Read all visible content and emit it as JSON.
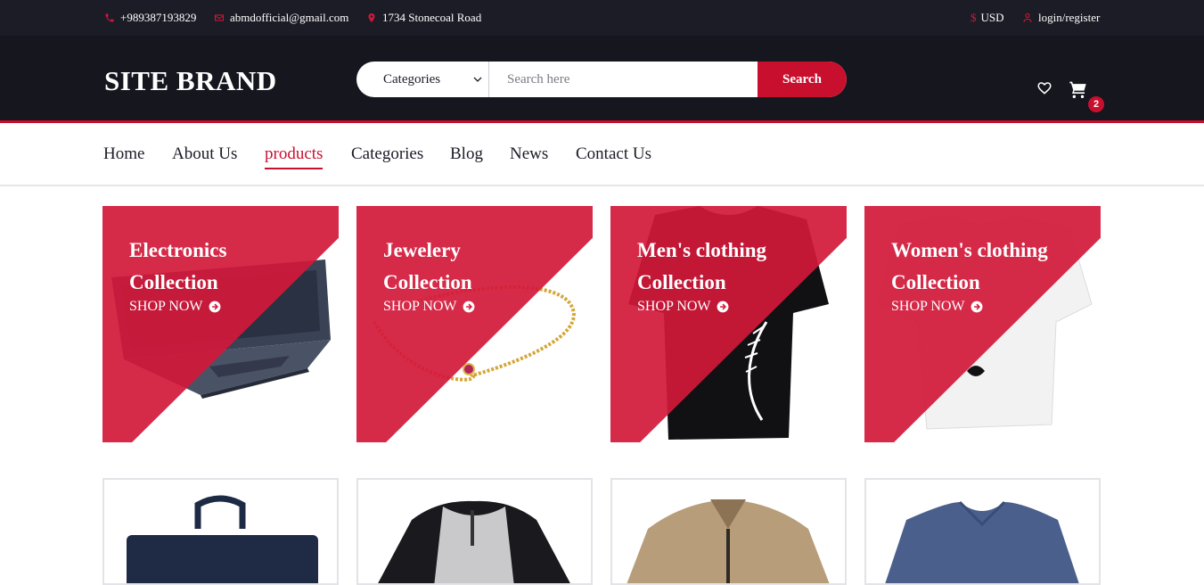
{
  "topbar": {
    "phone": "+989387193829",
    "email": "abmdofficial@gmail.com",
    "address": "1734 Stonecoal Road",
    "currency_symbol": "$",
    "currency": "USD",
    "login": "login/register"
  },
  "header": {
    "brand": "SITE BRAND",
    "category_select": "Categories",
    "search_placeholder": "Search here",
    "search_button": "Search",
    "cart_count": "2"
  },
  "nav": {
    "items": [
      "Home",
      "About Us",
      "products",
      "Categories",
      "Blog",
      "News",
      "Contact Us"
    ],
    "active": "products"
  },
  "banners": [
    {
      "line1": "Electronics",
      "line2": "Collection",
      "cta": "SHOP NOW"
    },
    {
      "line1": "Jewelery",
      "line2": "Collection",
      "cta": "SHOP NOW"
    },
    {
      "line1": "Men's clothing",
      "line2": "Collection",
      "cta": "SHOP NOW"
    },
    {
      "line1": "Women's clothing",
      "line2": "Collection",
      "cta": "SHOP NOW"
    }
  ],
  "product_cards": [
    {
      "image": "navy-bag"
    },
    {
      "image": "raglan-henley-shirt"
    },
    {
      "image": "khaki-jacket"
    },
    {
      "image": "blue-vneck-tshirt"
    }
  ],
  "colors": {
    "accent": "#c8102e",
    "topbar_bg": "#1c1c26",
    "header_bg": "#16161f"
  }
}
